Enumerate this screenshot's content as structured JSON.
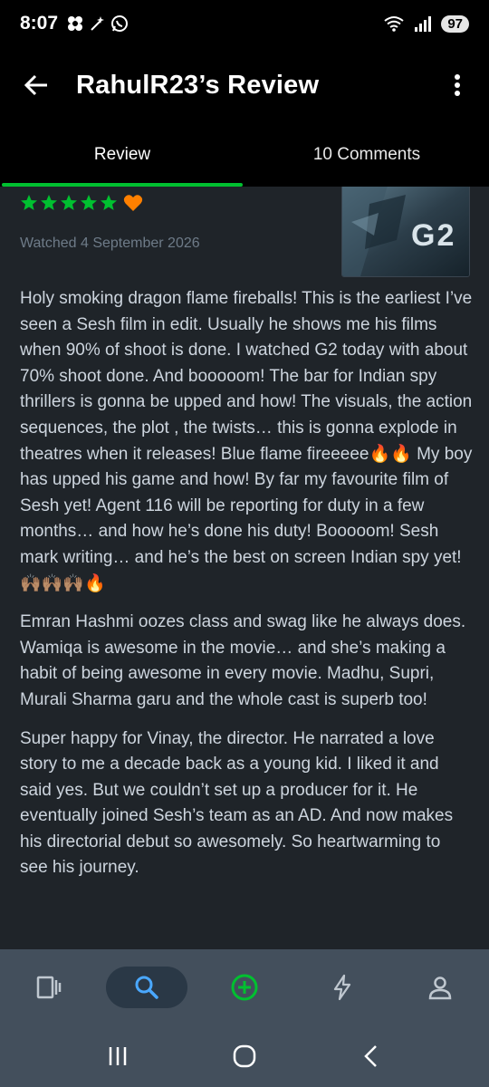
{
  "status": {
    "time": "8:07",
    "battery": "97"
  },
  "app_bar": {
    "title": "RahulR23’s Review"
  },
  "tabs": [
    {
      "label": "Review"
    },
    {
      "label": "10 Comments"
    }
  ],
  "review": {
    "rating": 5,
    "liked": true,
    "watched": "Watched 4 September 2026",
    "poster_text": "G2",
    "paragraphs": [
      "Holy smoking dragon flame fireballs! This is the earliest I’ve seen a Sesh film in edit. Usually he shows me his films when 90% of shoot is done. I watched G2 today with about 70% shoot done. And booooom! The bar for Indian spy thrillers is gonna be upped and how! The visuals, the action sequences, the plot , the twists… this is gonna explode in theatres when it releases! Blue flame fireeeee🔥🔥 My boy has upped his game and how! By far my favourite film of Sesh yet! Agent 116 will be reporting for duty in a few months… and how he’s done his duty! Booooom! Sesh mark writing… and he’s the best on screen Indian spy yet! 🙌🏽🙌🏽🙌🏽🔥",
      "Emran Hashmi oozes class and swag like he always does. Wamiqa is awesome in the movie… and she’s making a habit of being awesome in every movie. Madhu, Supri, Murali Sharma garu and the whole cast is superb too!",
      "Super happy for Vinay, the director. He narrated a love story to me a decade back as a young kid. I liked it and said yes. But we couldn’t set up a producer for it. He eventually joined Sesh’s team as an AD. And now makes his directorial debut so awesomely. So heartwarming to see his journey."
    ]
  },
  "colors": {
    "accent_green": "#00c030",
    "heart_orange": "#ff8000",
    "nav_bg": "#434f5c"
  },
  "bottom_nav": [
    "films-icon",
    "search-icon",
    "add-icon",
    "activity-icon",
    "profile-icon"
  ]
}
